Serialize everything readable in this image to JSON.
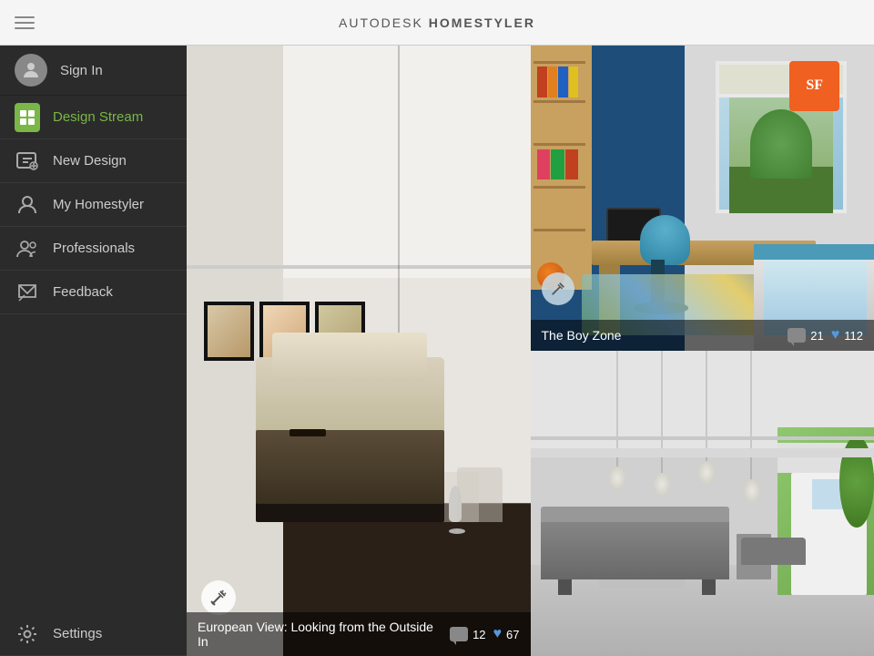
{
  "header": {
    "title_prefix": "AUTODESK",
    "title_suffix": "HOMESTYLER",
    "trademark": "®"
  },
  "sidebar": {
    "sign_in_label": "Sign In",
    "items": [
      {
        "id": "design-stream",
        "label": "Design Stream",
        "active": true
      },
      {
        "id": "new-design",
        "label": "New Design",
        "active": false
      },
      {
        "id": "my-homestyler",
        "label": "My Homestyler",
        "active": false
      },
      {
        "id": "professionals",
        "label": "Professionals",
        "active": false
      },
      {
        "id": "feedback",
        "label": "Feedback",
        "active": false
      },
      {
        "id": "settings",
        "label": "Settings",
        "active": false
      }
    ]
  },
  "designs": {
    "large_card": {
      "title": "European View: Looking from the Outside In",
      "comments": "12",
      "likes": "67"
    },
    "top_right_card": {
      "title": "The Boy Zone",
      "comments": "21",
      "likes": "112"
    },
    "bottom_right_card": {
      "title": "",
      "comments": "",
      "likes": ""
    }
  }
}
